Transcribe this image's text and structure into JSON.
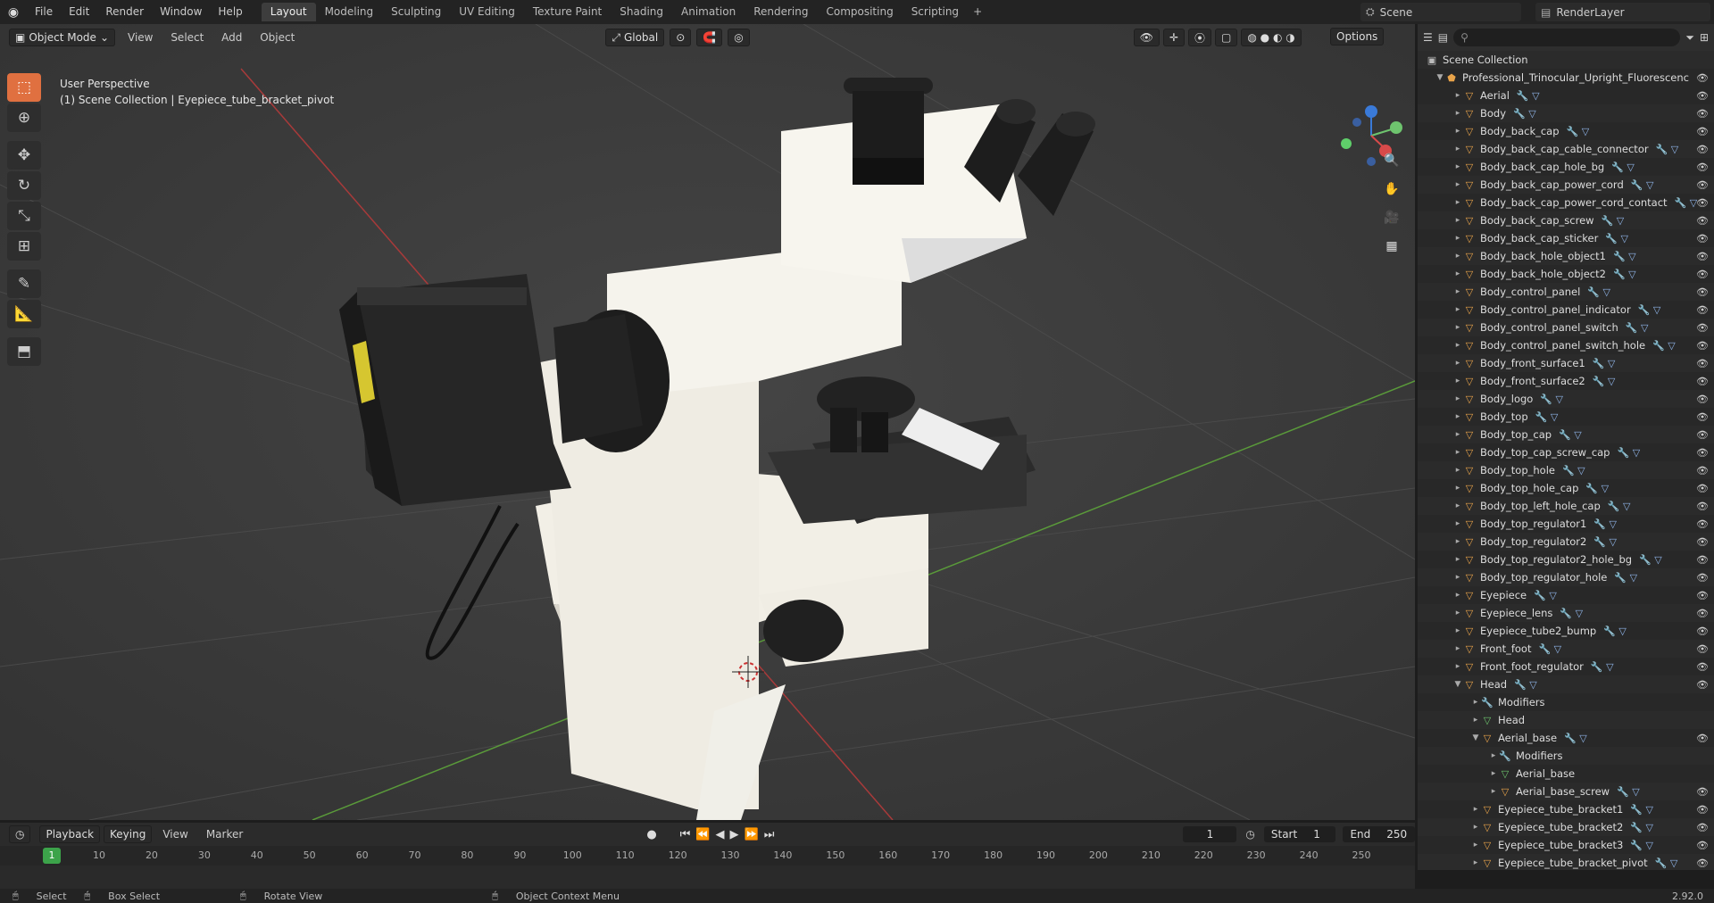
{
  "topbar": {
    "menu": [
      "File",
      "Edit",
      "Render",
      "Window",
      "Help"
    ],
    "workspaces": [
      "Layout",
      "Modeling",
      "Sculpting",
      "UV Editing",
      "Texture Paint",
      "Shading",
      "Animation",
      "Rendering",
      "Compositing",
      "Scripting"
    ],
    "active_workspace": "Layout",
    "scene": "Scene",
    "render_layer": "RenderLayer"
  },
  "viewport": {
    "mode": "Object Mode",
    "menu": [
      "View",
      "Select",
      "Add",
      "Object"
    ],
    "orientation": "Global",
    "options": "Options",
    "perspective": "User Perspective",
    "collection_info": "(1) Scene Collection | Eyepiece_tube_bracket_pivot"
  },
  "outliner": {
    "root": "Scene Collection",
    "collection": "Professional_Trinocular_Upright_Fluorescenc",
    "items": [
      {
        "name": "Aerial",
        "indent": 1,
        "type": "mesh"
      },
      {
        "name": "Body",
        "indent": 1,
        "type": "mesh"
      },
      {
        "name": "Body_back_cap",
        "indent": 1,
        "type": "mesh"
      },
      {
        "name": "Body_back_cap_cable_connector",
        "indent": 1,
        "type": "mesh"
      },
      {
        "name": "Body_back_cap_hole_bg",
        "indent": 1,
        "type": "mesh"
      },
      {
        "name": "Body_back_cap_power_cord",
        "indent": 1,
        "type": "mesh"
      },
      {
        "name": "Body_back_cap_power_cord_contact",
        "indent": 1,
        "type": "mesh"
      },
      {
        "name": "Body_back_cap_screw",
        "indent": 1,
        "type": "mesh"
      },
      {
        "name": "Body_back_cap_sticker",
        "indent": 1,
        "type": "mesh"
      },
      {
        "name": "Body_back_hole_object1",
        "indent": 1,
        "type": "mesh"
      },
      {
        "name": "Body_back_hole_object2",
        "indent": 1,
        "type": "mesh"
      },
      {
        "name": "Body_control_panel",
        "indent": 1,
        "type": "mesh"
      },
      {
        "name": "Body_control_panel_indicator",
        "indent": 1,
        "type": "mesh"
      },
      {
        "name": "Body_control_panel_switch",
        "indent": 1,
        "type": "mesh"
      },
      {
        "name": "Body_control_panel_switch_hole",
        "indent": 1,
        "type": "mesh"
      },
      {
        "name": "Body_front_surface1",
        "indent": 1,
        "type": "mesh"
      },
      {
        "name": "Body_front_surface2",
        "indent": 1,
        "type": "mesh"
      },
      {
        "name": "Body_logo",
        "indent": 1,
        "type": "mesh"
      },
      {
        "name": "Body_top",
        "indent": 1,
        "type": "mesh"
      },
      {
        "name": "Body_top_cap",
        "indent": 1,
        "type": "mesh"
      },
      {
        "name": "Body_top_cap_screw_cap",
        "indent": 1,
        "type": "mesh"
      },
      {
        "name": "Body_top_hole",
        "indent": 1,
        "type": "mesh"
      },
      {
        "name": "Body_top_hole_cap",
        "indent": 1,
        "type": "mesh"
      },
      {
        "name": "Body_top_left_hole_cap",
        "indent": 1,
        "type": "mesh"
      },
      {
        "name": "Body_top_regulator1",
        "indent": 1,
        "type": "mesh"
      },
      {
        "name": "Body_top_regulator2",
        "indent": 1,
        "type": "mesh"
      },
      {
        "name": "Body_top_regulator2_hole_bg",
        "indent": 1,
        "type": "mesh"
      },
      {
        "name": "Body_top_regulator_hole",
        "indent": 1,
        "type": "mesh"
      },
      {
        "name": "Eyepiece",
        "indent": 1,
        "type": "mesh"
      },
      {
        "name": "Eyepiece_lens",
        "indent": 1,
        "type": "mesh"
      },
      {
        "name": "Eyepiece_tube2_bump",
        "indent": 1,
        "type": "mesh"
      },
      {
        "name": "Front_foot",
        "indent": 1,
        "type": "mesh"
      },
      {
        "name": "Front_foot_regulator",
        "indent": 1,
        "type": "mesh"
      },
      {
        "name": "Head",
        "indent": 1,
        "type": "mesh"
      },
      {
        "name": "Modifiers",
        "indent": 2,
        "type": "modifier"
      },
      {
        "name": "Head",
        "indent": 2,
        "type": "data"
      },
      {
        "name": "Aerial_base",
        "indent": 2,
        "type": "mesh"
      },
      {
        "name": "Modifiers",
        "indent": 3,
        "type": "modifier"
      },
      {
        "name": "Aerial_base",
        "indent": 3,
        "type": "data"
      },
      {
        "name": "Aerial_base_screw",
        "indent": 3,
        "type": "mesh"
      },
      {
        "name": "Eyepiece_tube_bracket1",
        "indent": 2,
        "type": "mesh"
      },
      {
        "name": "Eyepiece_tube_bracket2",
        "indent": 2,
        "type": "mesh"
      },
      {
        "name": "Eyepiece_tube_bracket3",
        "indent": 2,
        "type": "mesh"
      },
      {
        "name": "Eyepiece_tube_bracket_pivot",
        "indent": 2,
        "type": "mesh"
      }
    ]
  },
  "timeline": {
    "menu": [
      "Playback",
      "Keying",
      "View",
      "Marker"
    ],
    "current_frame": "1",
    "start_label": "Start",
    "start": "1",
    "end_label": "End",
    "end": "250",
    "ticks": [
      "10",
      "20",
      "30",
      "40",
      "50",
      "60",
      "70",
      "80",
      "90",
      "100",
      "110",
      "120",
      "130",
      "140",
      "150",
      "160",
      "170",
      "180",
      "190",
      "200",
      "210",
      "220",
      "230",
      "240",
      "250"
    ],
    "playhead": "1"
  },
  "statusbar": {
    "select": "Select",
    "box_select": "Box Select",
    "rotate": "Rotate View",
    "context": "Object Context Menu",
    "version": "2.92.0"
  },
  "colors": {
    "accent": "#e07040",
    "playhead": "#3ca34a",
    "x_axis": "#a83a3a",
    "y_axis": "#5a9a3a"
  }
}
